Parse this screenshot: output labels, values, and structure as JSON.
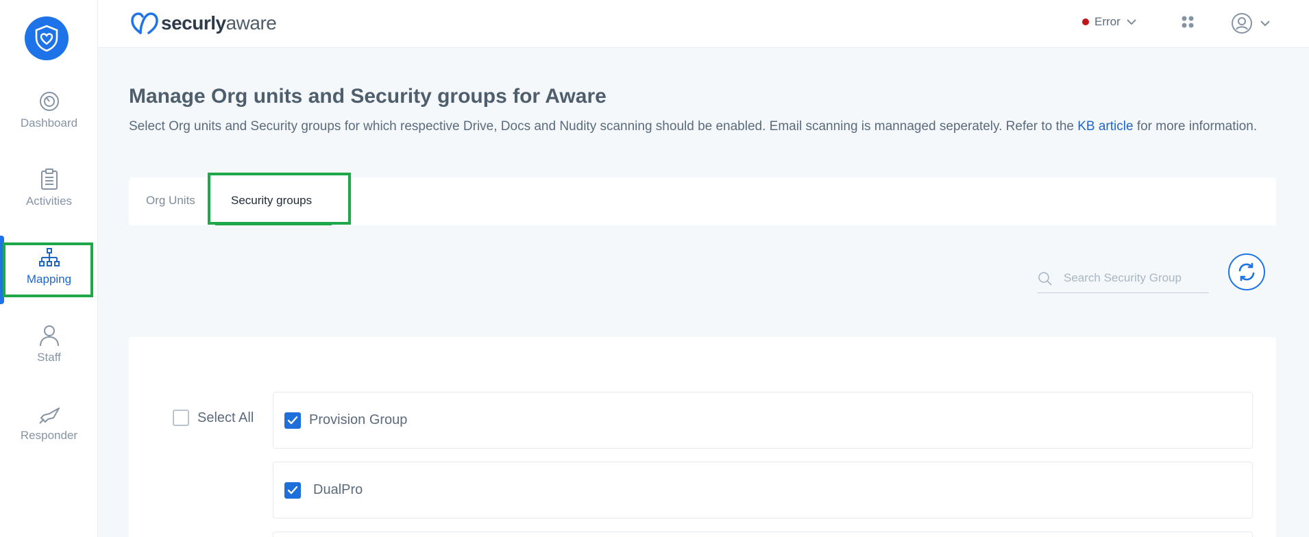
{
  "sidebar": {
    "logo": "shield-heart-logo",
    "items": [
      {
        "label": "Dashboard",
        "icon": "gauge-icon"
      },
      {
        "label": "Activities",
        "icon": "clipboard-icon"
      },
      {
        "label": "Mapping",
        "icon": "org-chart-icon",
        "active": true
      },
      {
        "label": "Staff",
        "icon": "user-icon"
      },
      {
        "label": "Responder",
        "icon": "megaphone-icon"
      }
    ]
  },
  "header": {
    "brand_bold": "securly",
    "brand_light": "aware",
    "status_label": "Error",
    "status_color": "#c0151b"
  },
  "page": {
    "title": "Manage Org units and Security groups for Aware",
    "description_before": "Select Org units and Security groups for which respective Drive, Docs and Nudity scanning should be enabled. Email scanning is mannaged seperately. Refer to the ",
    "kb_link": "KB article",
    "description_after": " for more information."
  },
  "tabs": [
    {
      "label": "Org Units",
      "active": false
    },
    {
      "label": "Security groups",
      "active": true
    }
  ],
  "search": {
    "placeholder": "Search Security Group"
  },
  "select_all": {
    "label": "Select All",
    "checked": false
  },
  "groups": [
    {
      "name": "Provision Group",
      "checked": true
    },
    {
      "name": "DualPro",
      "checked": true
    }
  ],
  "colors": {
    "accent": "#1e73e8",
    "highlight": "#1fa84a",
    "link": "#1e66c8"
  }
}
